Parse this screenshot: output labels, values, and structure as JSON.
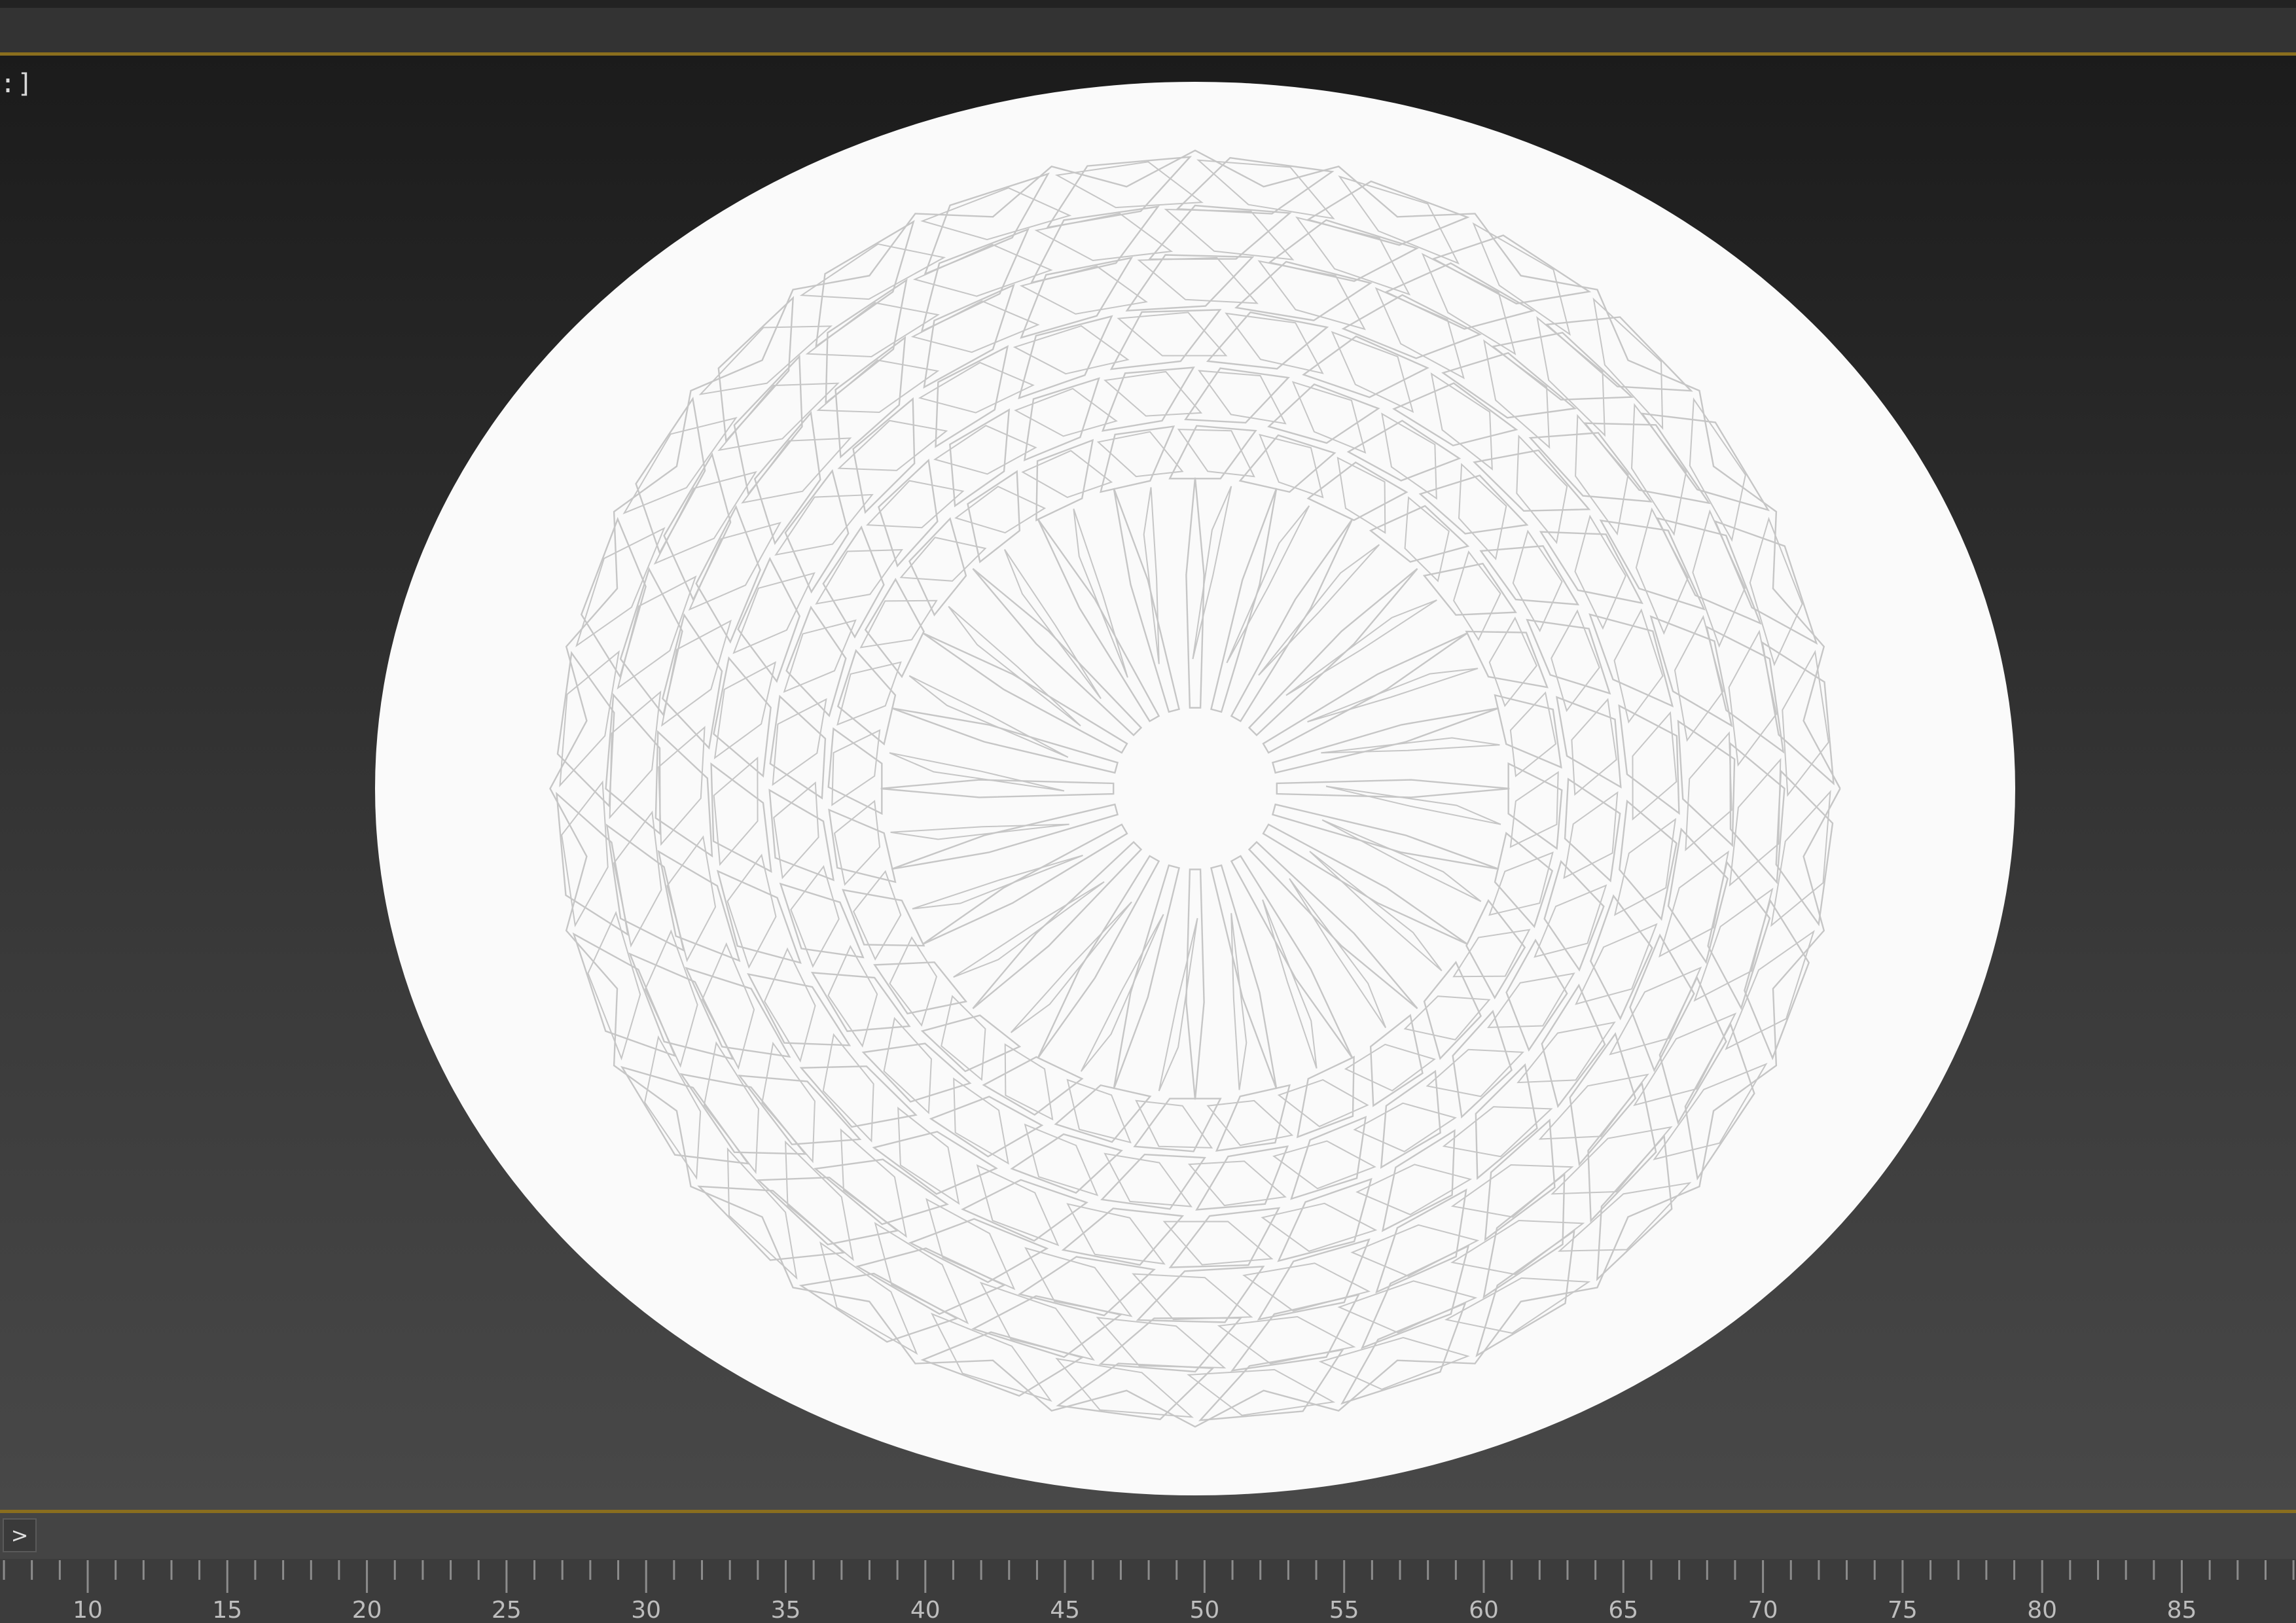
{
  "viewport": {
    "label": ":]",
    "object": "circular-panel-with-lattice-pattern"
  },
  "track_bar": {
    "expand_label": ">"
  },
  "time_ruler": {
    "labels": [
      "10",
      "15",
      "20",
      "25",
      "30",
      "35",
      "40",
      "45",
      "50",
      "55",
      "60",
      "65",
      "70",
      "75",
      "80",
      "85"
    ]
  },
  "colors": {
    "frame_accent": "#8a6e1e",
    "panel_fill": "#fafafa",
    "pattern_line": "#c6c6c6"
  }
}
